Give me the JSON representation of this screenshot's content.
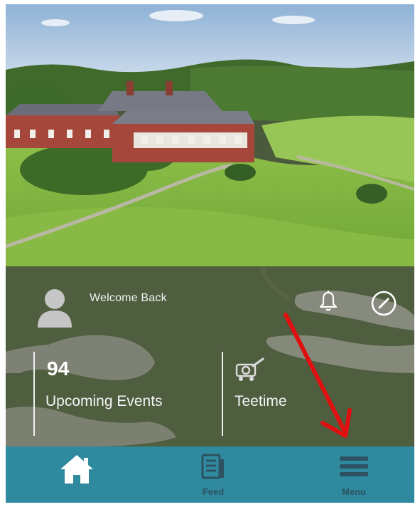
{
  "dashboard": {
    "welcome_text": "Welcome Back",
    "events": {
      "count": "94",
      "label": "Upcoming Events"
    },
    "teetime": {
      "label": "Teetime"
    }
  },
  "bottom_nav": {
    "items": [
      {
        "label": "",
        "icon": "home-icon"
      },
      {
        "label": "Feed",
        "icon": "feed-icon"
      },
      {
        "label": "Menu",
        "icon": "menu-icon"
      }
    ]
  },
  "colors": {
    "nav_background": "#2f8aa0",
    "nav_label": "#2d5360",
    "annotation_arrow": "#e01010"
  }
}
